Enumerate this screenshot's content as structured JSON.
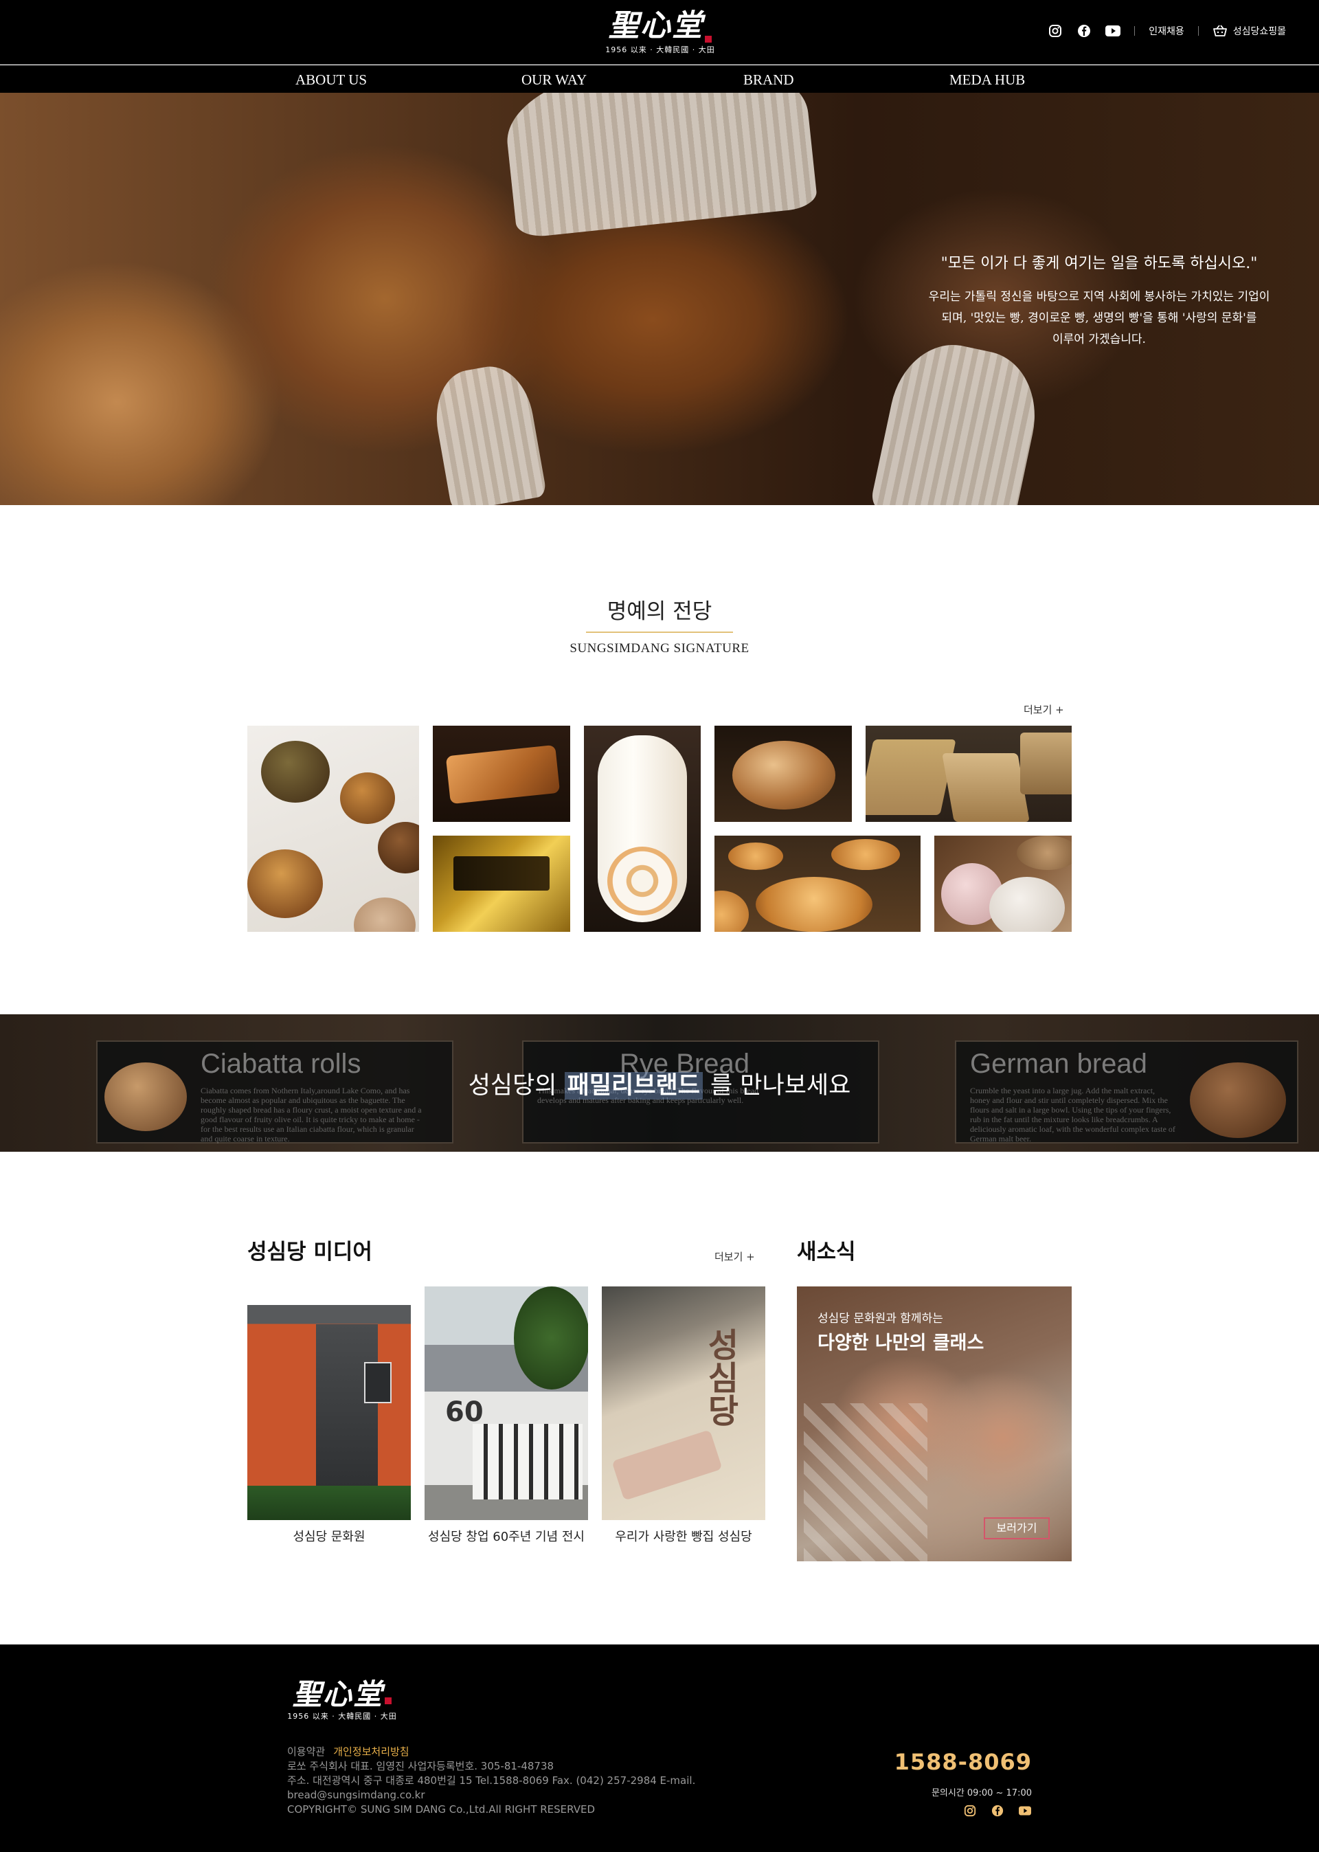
{
  "header": {
    "logo_mark": "聖心堂",
    "logo_since": "1956 以来 · 大韓民國 · 大田",
    "utility": {
      "icons": [
        "instagram-icon",
        "facebook-icon",
        "youtube-icon"
      ],
      "recruit": "인재채용",
      "shop": "성심당쇼핑몰"
    },
    "nav": [
      "ABOUT US",
      "OUR WAY",
      "BRAND",
      "MEDA HUB"
    ]
  },
  "hero": {
    "quote": "\"모든 이가 다 좋게 여기는 일을 하도록 하십시오.\"",
    "body_line1": "우리는 가톨릭 정신을 바탕으로 지역 사회에 봉사하는 가치있는 기업이",
    "body_line2": "되며, '맛있는 빵, 경이로운 빵, 생명의 빵'을 통해 '사랑의 문화'를",
    "body_line3": "이루어 가겠습니다."
  },
  "signature": {
    "title": "명예의 전당",
    "subtitle": "SUNGSIMDANG SIGNATURE",
    "more": "더보기 +"
  },
  "family_band": {
    "boards": [
      {
        "title": "Ciabatta rolls",
        "body": "Ciabatta comes from Nothern Italy,around Lake Como, and has become almost as popular and ubiquitous as the baguette. The roughly shaped bread has a floury crust, a moist open texture and a good flavour of fruity olive oil. It is quite tricky to make at home - for the best results use an Italian ciabatta flour, which is granular and quite coarse in texture."
      },
      {
        "title": "Rye Bread",
        "body": "This makes a traditional, dense rye bread. The flavour of this bread develops and matures after baking and keeps particularly well."
      },
      {
        "title": "German bread",
        "body": "Crumble the yeast into a large jug. Add the malt extract, honey and flour and stir until completely dispersed. Mix the flours and salt in a large bowl. Using the tips of your fingers, rub in the fat until the mixture looks like breadcrumbs. A deliciously aromatic loaf, with the wonderful complex taste of German malt beer."
      }
    ],
    "cta_before": "성심당의 ",
    "cta_highlight": "패밀리브랜드",
    "cta_after": " 를 만나보세요"
  },
  "media": {
    "title": "성심당 미디어",
    "more": "더보기 +",
    "items": [
      {
        "caption": "성심당 문화원"
      },
      {
        "caption": "성심당 창업 60주년 기념 전시"
      },
      {
        "caption": "우리가 사랑한 빵집 성심당"
      }
    ]
  },
  "news": {
    "title": "새소식",
    "sub": "성심당 문화원과 함께하는",
    "main": "다양한 나만의 클래스",
    "button": "보러가기"
  },
  "footer": {
    "logo_mark": "聖心堂",
    "logo_since": "1956 以来 · 大韓民國 · 大田",
    "terms": "이용약관",
    "privacy": "개인정보처리방침",
    "company": "로쏘 주식회사   대표. 임영진   사업자등록번호. 305-81-48738",
    "address": "주소. 대전광역시 중구 대종로 480번길 15   Tel.1588-8069   Fax. (042) 257-2984   E-mail.",
    "email": "bread@sungsimdang.co.kr",
    "copyright": "COPYRIGHT© SUNG SIM DANG Co.,Ltd.All RIGHT RESERVED",
    "tel": "1588-8069",
    "hours": "문의시간 09:00 ~ 17:00",
    "icons": [
      "instagram-icon",
      "facebook-icon",
      "youtube-icon"
    ]
  },
  "colors": {
    "header_bg": "#000000",
    "accent_gold": "#e2c27a",
    "phone": "#f0c074",
    "privacy_link": "#e8b04a",
    "news_button_border": "#d4556a"
  }
}
